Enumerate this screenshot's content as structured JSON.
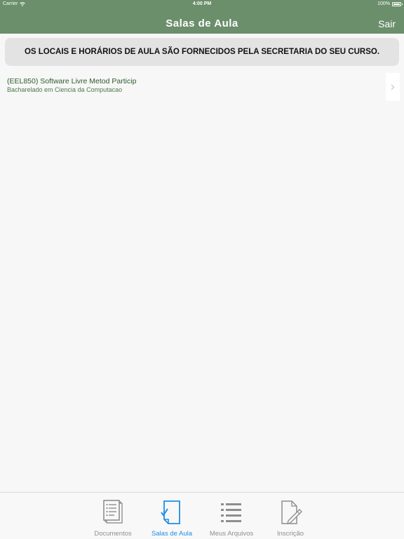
{
  "status_bar": {
    "carrier": "Carrier",
    "time": "4:00 PM",
    "battery": "100%",
    "battery_level": 1.0
  },
  "nav": {
    "title": "Salas de Aula",
    "logout_label": "Sair"
  },
  "notice": "OS LOCAIS E HORÁRIOS DE AULA SÃO FORNECIDOS PELA SECRETARIA DO SEU CURSO.",
  "classes": [
    {
      "name": "(EEL850) Software Livre Metod Particip",
      "course": "Bacharelado em Ciencia da Computacao"
    }
  ],
  "tabs": [
    {
      "label": "Documentos",
      "icon": "documents-icon",
      "active": false
    },
    {
      "label": "Salas de Aula",
      "icon": "classroom-icon",
      "active": true
    },
    {
      "label": "Meus Arquivos",
      "icon": "list-icon",
      "active": false
    },
    {
      "label": "Inscrição",
      "icon": "edit-document-icon",
      "active": false
    }
  ],
  "colors": {
    "header": "#6b8e6b",
    "active_tab": "#1e8ee8",
    "inactive_tab": "#8e8e8e",
    "class_name": "#2d5a2d"
  }
}
